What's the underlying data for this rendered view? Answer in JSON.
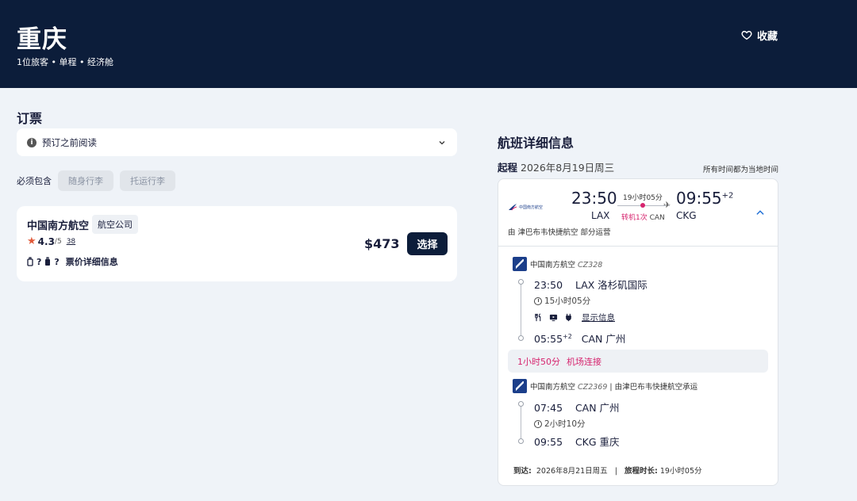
{
  "header": {
    "title": "重庆",
    "subtitle": "1位旅客 • 单程 • 经济舱",
    "save_label": "收藏"
  },
  "booking": {
    "title": "订票",
    "read_before": "预订之前阅读",
    "must_include_label": "必须包含",
    "chips": [
      "随身行李",
      "托运行李"
    ]
  },
  "flight_card": {
    "airline": "中国南方航空",
    "tag": "航空公司",
    "rating": "4.3",
    "rating_max": "/5",
    "review_count": "38",
    "bag_carryon": "?",
    "bag_checked": "?",
    "fare_details": "票价详细信息",
    "price": "$473",
    "select_label": "选择"
  },
  "details": {
    "title": "航班详细信息",
    "outbound_label": "起程",
    "outbound_date": "2026年8月19日周三",
    "local_time_note": "所有时间都为当地时间",
    "summary": {
      "logo_text": "中国南方航空",
      "dep_time": "23:50",
      "dep_code": "LAX",
      "duration": "19小时05分",
      "stops": "转机1次",
      "stop_code": "CAN",
      "arr_time": "09:55",
      "arr_plus": "+2",
      "arr_code": "CKG",
      "operated_by": "由 津巴布韦快捷航空 部分运营"
    },
    "segment1": {
      "airline": "中国南方航空",
      "flight_no": "CZ328",
      "dep_time": "23:50",
      "dep_airport": "LAX 洛杉矶国际",
      "duration": "15小时05分",
      "show_info": "显示信息",
      "arr_time": "05:55",
      "arr_plus": "+2",
      "arr_airport": "CAN 广州"
    },
    "layover": {
      "duration": "1小时50分",
      "label": "机场连接"
    },
    "segment2": {
      "airline": "中国南方航空",
      "flight_no": "CZ2369",
      "operated": " | 由津巴布韦快捷航空承运",
      "dep_time": "07:45",
      "dep_airport": "CAN 广州",
      "duration": "2小时10分",
      "arr_time": "09:55",
      "arr_airport": "CKG 重庆"
    },
    "arrival": {
      "label": "到达:",
      "date": "2026年8月21日周五",
      "sep": "|",
      "trip_label": "旅程时长:",
      "trip_duration": "19小时05分"
    }
  },
  "colors": {
    "header_bg": "#0c1d3a",
    "accent_pink": "#d6246e",
    "page_bg": "#eff3f8",
    "star": "#e15a3a"
  }
}
